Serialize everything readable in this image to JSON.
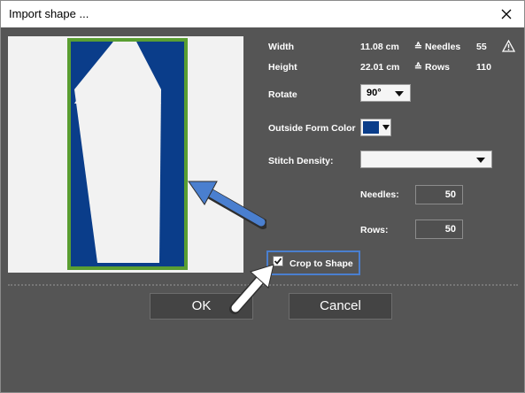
{
  "window": {
    "title": "Import shape ..."
  },
  "info": {
    "width_label": "Width",
    "width_value": "11.08 cm",
    "needles_label": "Needles",
    "needles_value": "55",
    "height_label": "Height",
    "height_value": "22.01 cm",
    "rows_label": "Rows",
    "rows_value": "110",
    "eq_symbol": "≙"
  },
  "rotate": {
    "label": "Rotate",
    "value": "90°"
  },
  "outside_color": {
    "label": "Outside Form Color",
    "color": "#0a3d8a"
  },
  "stitch_density": {
    "label": "Stitch Density:",
    "value": ""
  },
  "needles": {
    "label": "Needles:",
    "value": "50"
  },
  "rows": {
    "label": "Rows:",
    "value": "50"
  },
  "crop": {
    "label": "Crop to Shape",
    "checked": true
  },
  "buttons": {
    "ok": "OK",
    "cancel": "Cancel"
  },
  "colors": {
    "dialog_bg": "#555555",
    "shape_fill": "#0a3d8a",
    "frame_green": "#5a9e32",
    "highlight_blue": "#4a7fcf",
    "arrow_blue": "#4a7fcf"
  }
}
